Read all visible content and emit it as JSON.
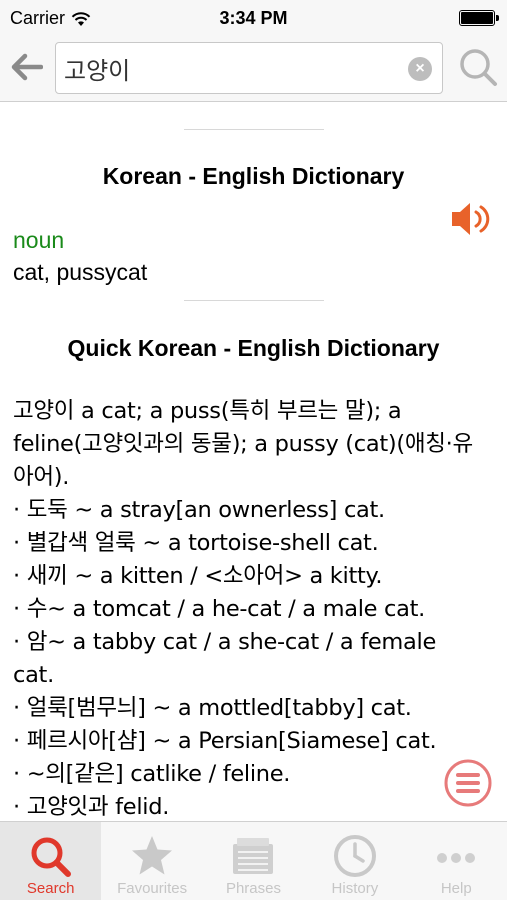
{
  "status_bar": {
    "carrier": "Carrier",
    "time": "3:34 PM"
  },
  "search": {
    "value": "고양이",
    "placeholder": ""
  },
  "dictionary1": {
    "title": "Korean - English Dictionary",
    "part_of_speech": "noun",
    "meaning": "cat, pussycat"
  },
  "dictionary2": {
    "title": "Quick Korean - English Dictionary",
    "lines": [
      "고양이 a cat; a puss(특히 부르는 말); a",
      "feline(고양잇과의 동물); a pussy (cat)(애칭·유",
      "아어).",
      "· 도둑 ~ a stray[an ownerless] cat.",
      "· 별갑색 얼룩 ~ a tortoise-shell cat.",
      "· 새끼 ~ a kitten / <소아어> a kitty.",
      "· 수~ a tomcat / a he-cat / a male cat.",
      "· 암~ a tabby cat / a she-cat / a female",
      "cat.",
      "· 얼룩[범무늬] ~ a mottled[tabby] cat.",
      "· 페르시아[샴] ~ a Persian[Siamese] cat.",
      "· ~의[같은] catlike / feline.",
      "· 고양잇과 felid."
    ]
  },
  "tabs": [
    {
      "label": "Search",
      "icon": "search-icon",
      "active": true
    },
    {
      "label": "Favourites",
      "icon": "star-icon",
      "active": false
    },
    {
      "label": "Phrases",
      "icon": "phrases-icon",
      "active": false
    },
    {
      "label": "History",
      "icon": "clock-icon",
      "active": false
    },
    {
      "label": "Help",
      "icon": "more-icon",
      "active": false
    }
  ],
  "colors": {
    "accent": "#e0382b",
    "pos_green": "#1a8a1a",
    "speaker_orange": "#e8622a",
    "inactive": "#c6c6c6"
  }
}
